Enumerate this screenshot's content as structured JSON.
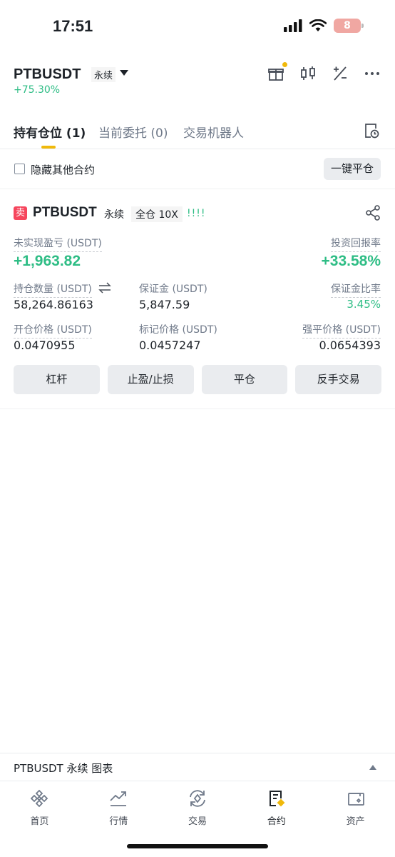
{
  "status_bar": {
    "time": "17:51",
    "battery": "8"
  },
  "header": {
    "symbol": "PTBUSDT",
    "contract_type": "永续",
    "change": "+75.30%"
  },
  "tabs": [
    {
      "label": "持有仓位 (1)"
    },
    {
      "label": "当前委托 (0)"
    },
    {
      "label": "交易机器人"
    }
  ],
  "filter": {
    "hide_other_label": "隐藏其他合约",
    "close_all_label": "一键平仓"
  },
  "position": {
    "side_badge": "卖",
    "symbol": "PTBUSDT",
    "contract_type": "永续",
    "margin_mode": "全仓 10X",
    "bars": "!!!!",
    "unrealized_pnl_label": "未实现盈亏 (USDT)",
    "unrealized_pnl": "+1,963.82",
    "roi_label": "投资回报率",
    "roi": "+33.58%",
    "size_label": "持仓数量 (USDT)",
    "size": "58,264.86163",
    "margin_label": "保证金 (USDT)",
    "margin": "5,847.59",
    "margin_ratio_label": "保证金比率",
    "margin_ratio": "3.45%",
    "entry_price_label": "开仓价格 (USDT)",
    "entry_price": "0.0470955",
    "mark_price_label": "标记价格 (USDT)",
    "mark_price": "0.0457247",
    "liq_price_label": "强平价格 (USDT)",
    "liq_price": "0.0654393",
    "actions": [
      "杠杆",
      "止盈/止损",
      "平仓",
      "反手交易"
    ]
  },
  "chart_bar": {
    "label": "PTBUSDT 永续  图表"
  },
  "bottom_nav": [
    {
      "label": "首页",
      "icon": "binance-logo-icon"
    },
    {
      "label": "行情",
      "icon": "market-chart-icon"
    },
    {
      "label": "交易",
      "icon": "trade-swap-icon"
    },
    {
      "label": "合约",
      "icon": "futures-icon"
    },
    {
      "label": "资产",
      "icon": "wallet-icon"
    }
  ],
  "colors": {
    "green": "#2ebd85",
    "red": "#f6465d",
    "accent": "#f0b90b"
  }
}
